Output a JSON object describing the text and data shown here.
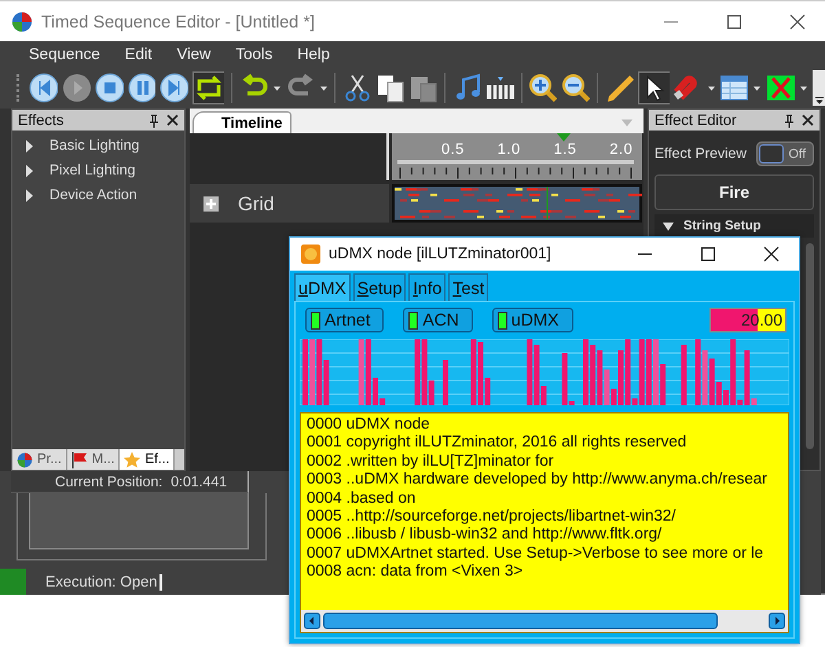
{
  "main_window": {
    "title": "Timed Sequence Editor - [Untitled *]"
  },
  "menu": [
    "Sequence",
    "Edit",
    "View",
    "Tools",
    "Help"
  ],
  "effects_panel": {
    "title": "Effects",
    "items": [
      {
        "label": "Basic Lighting",
        "expanded": false
      },
      {
        "label": "Pixel Lighting",
        "expanded": false
      },
      {
        "label": "Device Action",
        "expanded": false
      }
    ],
    "tabs": [
      {
        "label": "Pr...",
        "kind": "logo",
        "selected": false
      },
      {
        "label": "M...",
        "kind": "flag",
        "selected": false
      },
      {
        "label": "Ef...",
        "kind": "star",
        "selected": true
      }
    ]
  },
  "timeline": {
    "tab": "Timeline",
    "ruler": [
      "0.5",
      "1.0",
      "1.5",
      "2.0"
    ],
    "rows": [
      {
        "label": "Grid",
        "expanded": false
      }
    ]
  },
  "effect_editor": {
    "title": "Effect Editor",
    "preview_label": "Effect Preview",
    "preview_toggle": {
      "label": "Off",
      "on": false
    },
    "effect_name": "Fire",
    "section": {
      "label": "String Setup",
      "expanded": true
    }
  },
  "status": {
    "position_label": "Current Position:",
    "position": "0:01.441",
    "execution": "Execution: Open"
  },
  "udmx_window": {
    "title": "uDMX node [ilLUTZminator001]",
    "tabs": [
      {
        "label": "uDMX",
        "selected": true
      },
      {
        "label": "Setup",
        "selected": false
      },
      {
        "label": "Info",
        "selected": false
      },
      {
        "label": "Test",
        "selected": false
      }
    ],
    "indicators": [
      {
        "label": "Artnet",
        "on": true
      },
      {
        "label": "ACN",
        "on": true
      },
      {
        "label": "uDMX",
        "on": true
      }
    ],
    "rate": {
      "value": "20.00",
      "level": 0.63
    },
    "log": [
      "0000 uDMX node",
      "0001 copyright ilLUTZminator, 2016 all rights reserved",
      "0002 .written by ilLU[TZ]minator for",
      "0003 ..uDMX hardware developed by http://www.anyma.ch/resear",
      "0004 .based on",
      "0005 ..http://sourceforge.net/projects/libartnet-win32/",
      "0006 ..libusb / libusb-win32 and http://www.fltk.org/",
      "0007 uDMXArtnet started. Use Setup->Verbose to see more or le",
      "0008 acn: data from <Vixen 3>"
    ]
  }
}
